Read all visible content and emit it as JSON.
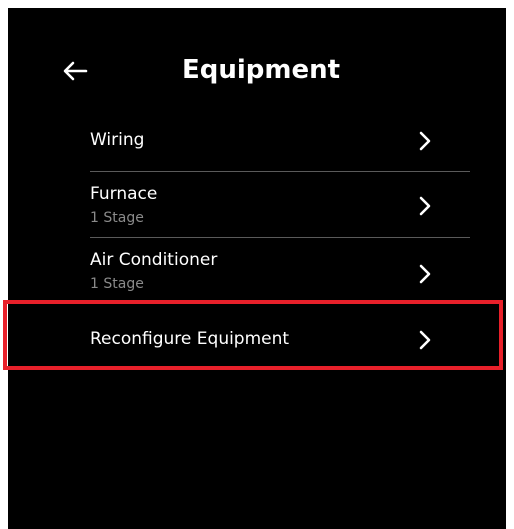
{
  "header": {
    "title": "Equipment",
    "back_icon": "arrow-left-icon"
  },
  "items": [
    {
      "label": "Wiring",
      "sublabel": ""
    },
    {
      "label": "Furnace",
      "sublabel": "1 Stage"
    },
    {
      "label": "Air Conditioner",
      "sublabel": "1 Stage"
    },
    {
      "label": "Reconfigure Equipment",
      "sublabel": ""
    }
  ],
  "colors": {
    "background": "#000000",
    "text": "#ffffff",
    "subtext": "#8a8a8a",
    "divider": "#5a5a5a",
    "highlight": "#e8202a"
  }
}
